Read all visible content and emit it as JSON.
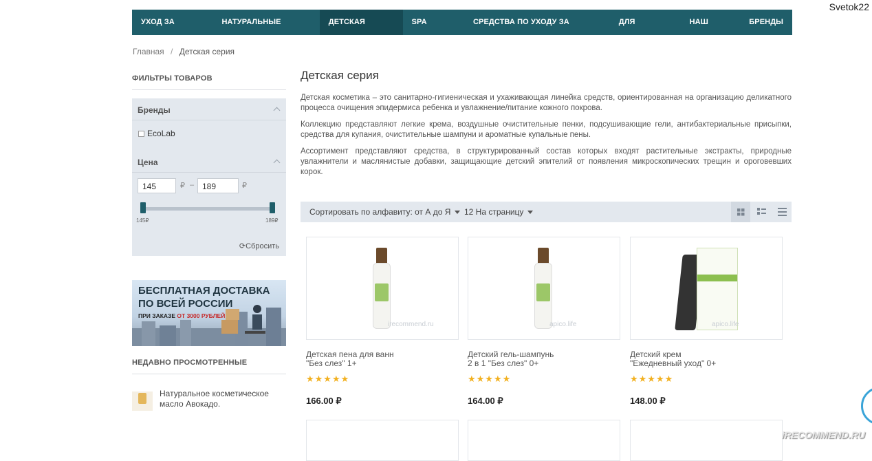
{
  "user": "Svetok22",
  "nav": [
    {
      "label": "УХОД ЗА ТЕЛОМ",
      "active": false
    },
    {
      "label": "НАТУРАЛЬНЫЕ МАСЛА",
      "active": false
    },
    {
      "label": "ДЕТСКАЯ СЕРИЯ",
      "active": true
    },
    {
      "label": "SPA СЕРИЯ",
      "active": false
    },
    {
      "label": "СРЕДСТВА ПО УХОДУ ЗА ДОМОМ",
      "active": false
    },
    {
      "label": "ДЛЯ МУЖЧИН",
      "active": false
    },
    {
      "label": "НАШ БЛОГ",
      "active": false
    },
    {
      "label": "БРЕНДЫ",
      "active": false
    }
  ],
  "breadcrumb": {
    "home": "Главная",
    "separator": "/",
    "current": "Детская серия"
  },
  "sidebar": {
    "filters_title": "ФИЛЬТРЫ ТОВАРОВ",
    "brands_label": "Бренды",
    "brand_option": "EcoLab",
    "price_label": "Цена",
    "price_min": "145",
    "price_max": "189",
    "currency": "₽",
    "dash": "–",
    "tick_min": "145₽",
    "tick_max": "189₽",
    "reset_label": "Сбросить",
    "banner_line1": "БЕСПЛАТНАЯ ДОСТАВКА",
    "banner_line2": "ПО ВСЕЙ РОССИИ",
    "banner_line3_a": "ПРИ ЗАКАЗЕ ",
    "banner_line3_b": "ОТ 3000 РУБЛЕЙ",
    "recent_title": "НЕДАВНО ПРОСМОТРЕННЫЕ",
    "recent_item": "Натуральное косметическое масло Авокадо."
  },
  "content": {
    "title": "Детская серия",
    "p1": "Детская косметика – это санитарно-гигиеническая и ухаживающая линейка средств, ориентированная на организацию деликатного процесса очищения эпидермиса ребенка и увлажнение/питание кожного покрова.",
    "p2": "Коллекцию представляют легкие крема, воздушные очистительные пенки, подсушивающие гели, антибактериальные присыпки, средства для купания, очистительные шампуни и ароматные купальные пены.",
    "p3": "Ассортимент представляют средства, в структурированный состав которых входят растительные экстракты, природные увлажнители и маслянистые добавки, защищающие детский эпителий от появления микроскопических трещин и ороговевших корок."
  },
  "toolbar": {
    "sort_label": "Сортировать по алфавиту: от А до Я",
    "per_page_label": "12 На страницу"
  },
  "products": [
    {
      "name_line1": "Детская пена для ванн",
      "name_line2": "\"Без слез\" 1+",
      "price": "166.00 ₽",
      "stars": "★★★★★",
      "watermark": "irecommend.ru"
    },
    {
      "name_line1": "Детский гель-шампунь",
      "name_line2": "2 в 1 \"Без слез\" 0+",
      "price": "164.00 ₽",
      "stars": "★★★★★",
      "watermark": "apico.life"
    },
    {
      "name_line1": "Детский крем",
      "name_line2": "\"Ежедневный уход\" 0+",
      "price": "148.00 ₽",
      "stars": "★★★★★",
      "watermark": "apico.life"
    }
  ],
  "colors": {
    "nav_bg": "#1f5e6a",
    "nav_active": "#164a54",
    "star": "#f2b01e",
    "filter_bg": "#e3e8ee"
  },
  "recommend_watermark": "iRECOMMEND.RU"
}
